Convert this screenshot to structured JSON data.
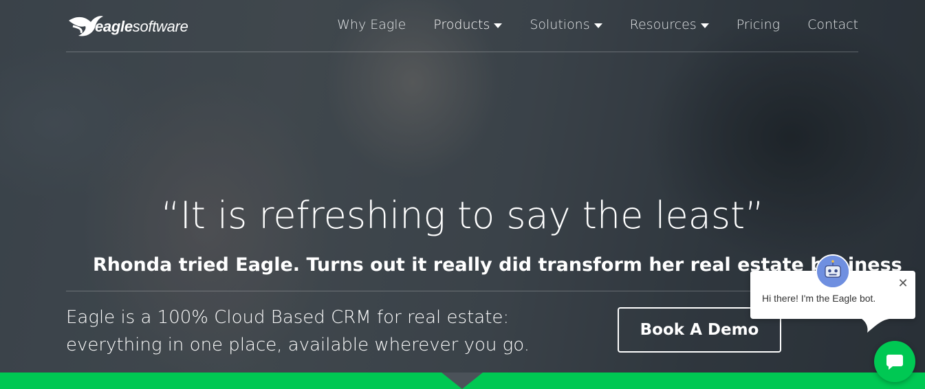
{
  "brand": {
    "logo_word_bold": "eagle",
    "logo_word_light": "software"
  },
  "nav": {
    "items": [
      {
        "label": "Why Eagle",
        "has_dropdown": false
      },
      {
        "label": "Products",
        "has_dropdown": true
      },
      {
        "label": "Solutions",
        "has_dropdown": true
      },
      {
        "label": "Resources",
        "has_dropdown": true
      },
      {
        "label": "Pricing",
        "has_dropdown": false
      },
      {
        "label": "Contact",
        "has_dropdown": false
      }
    ]
  },
  "hero": {
    "quote": "“It is refreshing to say the least”",
    "subheading": "Rhonda tried Eagle. Turns out it really did transform her real estate business",
    "tagline_line1": "Eagle is a 100% Cloud Based CRM for real estate:",
    "tagline_line2": "everything in one place, available wherever you go.",
    "cta_label": "Book A Demo"
  },
  "chat": {
    "greeting": "Hi there! I'm the Eagle bot.",
    "close_icon": "close-icon",
    "launcher_icon": "chat-bubble-icon"
  },
  "colors": {
    "accent_green": "#00c853",
    "text": "#ffffff"
  }
}
